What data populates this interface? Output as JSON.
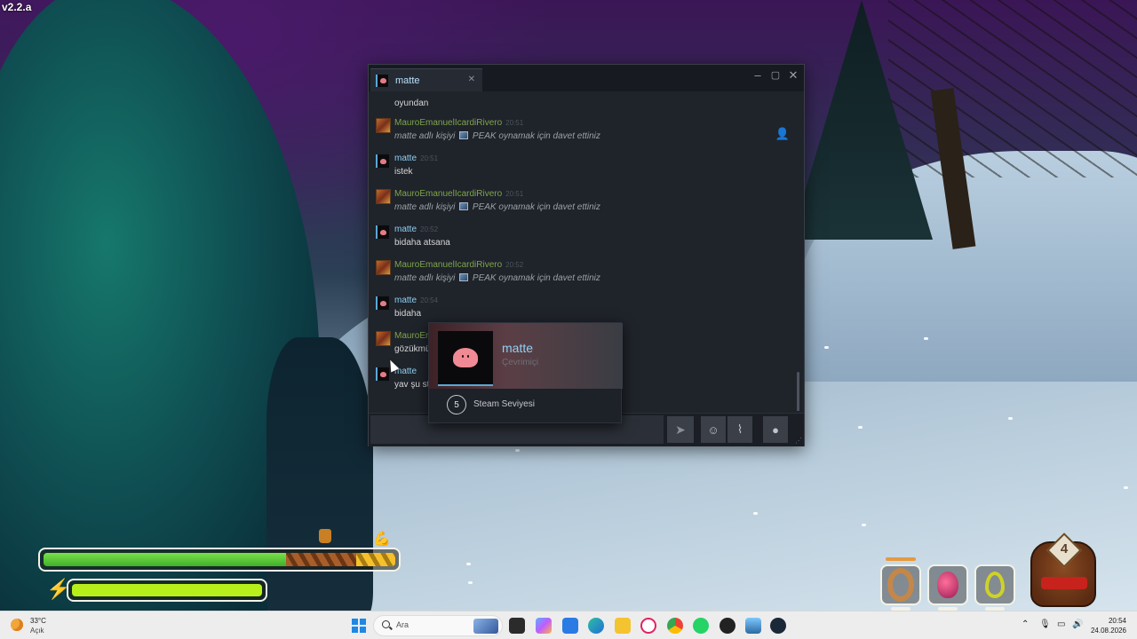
{
  "game": {
    "version": "v2.2.a",
    "hud": {
      "health_fraction": 0.69,
      "hunger_fraction": 0.2,
      "weight_fraction": 0.1,
      "stamina_fraction": 1.0,
      "backpack_count": "4"
    }
  },
  "chat": {
    "tab": {
      "label": "matte"
    },
    "first_line_text": "oyundan",
    "messages": [
      {
        "author": "MauroEmanuelIcardiRivero",
        "time": "20:51",
        "role": "self",
        "text_prefix": "matte adlı kişiyi",
        "text_suffix": "PEAK oynamak için davet ettiniz",
        "type": "invite"
      },
      {
        "author": "matte",
        "time": "20:51",
        "role": "friend",
        "text": "istek",
        "type": "text"
      },
      {
        "author": "MauroEmanuelIcardiRivero",
        "time": "20:51",
        "role": "self",
        "text_prefix": "matte adlı kişiyi",
        "text_suffix": "PEAK oynamak için davet ettiniz",
        "type": "invite"
      },
      {
        "author": "matte",
        "time": "20:52",
        "role": "friend",
        "text": "bidaha atsana",
        "type": "text"
      },
      {
        "author": "MauroEmanuelIcardiRivero",
        "time": "20:52",
        "role": "self",
        "text_prefix": "matte adlı kişiyi",
        "text_suffix": "PEAK oynamak için davet ettiniz",
        "type": "invite"
      },
      {
        "author": "matte",
        "time": "20:54",
        "role": "friend",
        "text": "bidaha",
        "type": "text"
      },
      {
        "author": "MauroEm",
        "time": "",
        "role": "self",
        "text": "gözükmü",
        "type": "text"
      },
      {
        "author": "matte",
        "time": "",
        "role": "friend",
        "text": "yav şu st",
        "type": "text"
      }
    ],
    "composer": {
      "placeholder": ""
    }
  },
  "profile_card": {
    "name": "matte",
    "status": "Çevrimiçi",
    "level": "5",
    "level_label": "Steam Seviyesi"
  },
  "taskbar": {
    "weather": {
      "temp": "33°C",
      "desc": "Açık"
    },
    "search_label": "Ara",
    "clock": {
      "time": "20:54",
      "date": "24.08.2026"
    }
  }
}
